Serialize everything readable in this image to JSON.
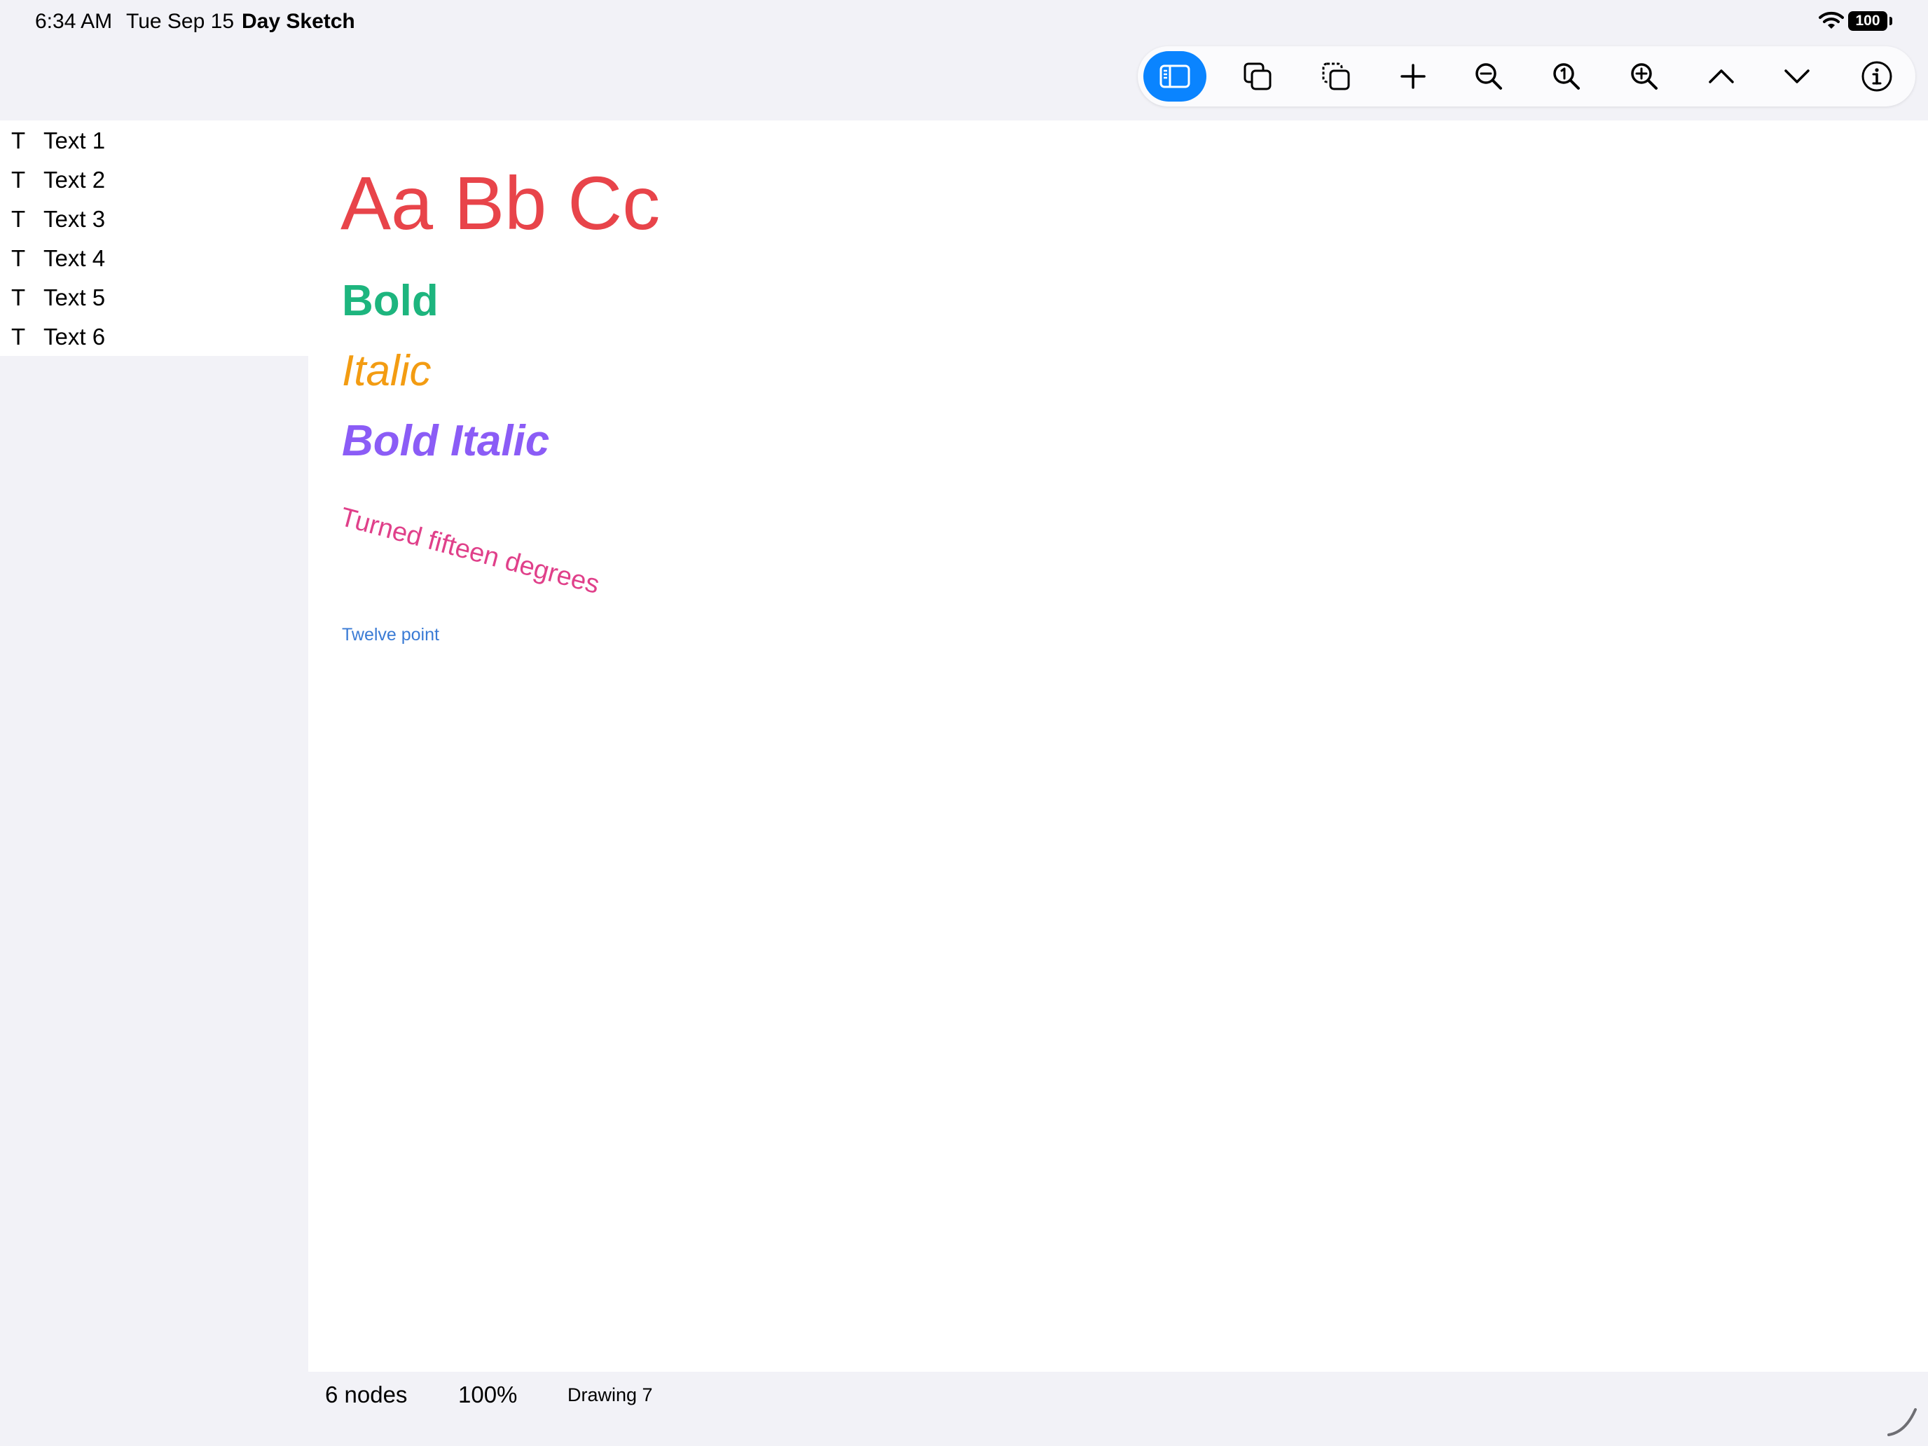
{
  "status_bar": {
    "time": "6:34 AM",
    "date": "Tue Sep 15",
    "app_name": "Day Sketch",
    "battery": "100"
  },
  "toolbar": {
    "buttons": [
      {
        "icon": "sidebar-icon",
        "active": true
      },
      {
        "icon": "duplicate-icon",
        "active": false
      },
      {
        "icon": "copy-selection-icon",
        "active": false
      },
      {
        "icon": "plus-icon",
        "active": false
      },
      {
        "icon": "zoom-out-icon",
        "active": false
      },
      {
        "icon": "zoom-actual-size-icon",
        "active": false
      },
      {
        "icon": "zoom-in-icon",
        "active": false
      },
      {
        "icon": "chevron-up-icon",
        "active": false
      },
      {
        "icon": "chevron-down-icon",
        "active": false
      },
      {
        "icon": "info-icon",
        "active": false
      }
    ],
    "accent_color": "#0a84ff"
  },
  "sidebar": {
    "items": [
      {
        "icon": "T",
        "label": "Text 1"
      },
      {
        "icon": "T",
        "label": "Text 2"
      },
      {
        "icon": "T",
        "label": "Text 3"
      },
      {
        "icon": "T",
        "label": "Text 4"
      },
      {
        "icon": "T",
        "label": "Text 5"
      },
      {
        "icon": "T",
        "label": "Text 6"
      }
    ]
  },
  "canvas": {
    "nodes": [
      {
        "text": "Aa Bb Cc",
        "color": "#e8444a"
      },
      {
        "text": "Bold",
        "color": "#1db57e"
      },
      {
        "text": "Italic",
        "color": "#f39c12"
      },
      {
        "text": "Bold Italic",
        "color": "#8b5cf6"
      },
      {
        "text": "Turned fifteen degrees",
        "color": "#e0408a"
      },
      {
        "text": "Twelve point",
        "color": "#3a7bd5"
      }
    ]
  },
  "bottom_bar": {
    "node_count": "6 nodes",
    "zoom": "100%",
    "document_name": "Drawing 7"
  }
}
